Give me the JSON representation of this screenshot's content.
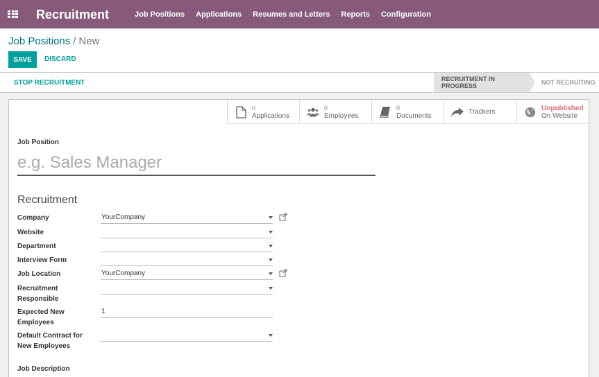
{
  "app": {
    "title": "Recruitment"
  },
  "menu": [
    "Job Positions",
    "Applications",
    "Resumes and Letters",
    "Reports",
    "Configuration"
  ],
  "breadcrumb": {
    "parent": "Job Positions",
    "separator": "/",
    "current": "New"
  },
  "actions": {
    "save": "SAVE",
    "discard": "DISCARD"
  },
  "statusbar": {
    "stop": "STOP RECRUITMENT",
    "stages": [
      "RECRUITMENT IN PROGRESS",
      "NOT RECRUITING"
    ],
    "active_stage": "RECRUITMENT IN PROGRESS"
  },
  "stat_buttons": {
    "applications": {
      "count": "0",
      "label": "Applications",
      "icon": "file-icon"
    },
    "employees": {
      "count": "0",
      "label": "Employees",
      "icon": "users-icon"
    },
    "documents": {
      "count": "0",
      "label": "Documents",
      "icon": "book-icon"
    },
    "trackers": {
      "label": "Trackers",
      "icon": "share-arrow-icon"
    },
    "website": {
      "status": "Unpublished",
      "label": "On Website",
      "icon": "globe-icon"
    }
  },
  "form": {
    "job_position_label": "Job Position",
    "job_position_placeholder": "e.g. Sales Manager",
    "section_title": "Recruitment",
    "fields": {
      "company": {
        "label": "Company",
        "value": "YourCompany"
      },
      "website": {
        "label": "Website",
        "value": ""
      },
      "department": {
        "label": "Department",
        "value": ""
      },
      "interview_form": {
        "label": "Interview Form",
        "value": ""
      },
      "job_location": {
        "label": "Job Location",
        "value": "YourCompany"
      },
      "recruitment_responsible": {
        "label": "Recruitment Responsible",
        "value": ""
      },
      "expected_new_employees": {
        "label": "Expected New Employees",
        "value": "1"
      },
      "default_contract": {
        "label": "Default Contract for New Employees",
        "value": ""
      }
    },
    "job_description_label": "Job Description"
  },
  "colors": {
    "brand": "#875a7b",
    "primary": "#00a09d",
    "link": "#00737c",
    "unpublished": "#e06c75"
  }
}
